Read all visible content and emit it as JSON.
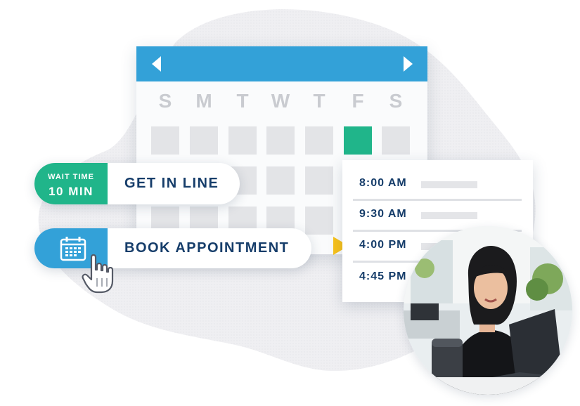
{
  "calendar": {
    "prev_icon": "chevron-left-icon",
    "next_icon": "chevron-right-icon",
    "weekdays": [
      "S",
      "M",
      "T",
      "W",
      "T",
      "F",
      "S"
    ],
    "selected_day_column": 6,
    "header_color": "#33a1d8",
    "selected_color": "#20b58a"
  },
  "wait_pill": {
    "badge_top": "WAIT TIME",
    "badge_bottom": "10 MIN",
    "label": "GET IN LINE",
    "color": "#20b58a"
  },
  "book_pill": {
    "icon": "calendar-icon",
    "label": "BOOK APPOINTMENT",
    "color": "#33a1d8",
    "cursor_icon": "hand-pointer-icon"
  },
  "times": {
    "slots": [
      "8:00 AM",
      "9:30 AM",
      "4:00 PM",
      "4:45 PM"
    ],
    "selected_index": 2,
    "pointer_color": "#f8c21b"
  },
  "photo": {
    "icon": "woman-with-laptop-photo"
  }
}
